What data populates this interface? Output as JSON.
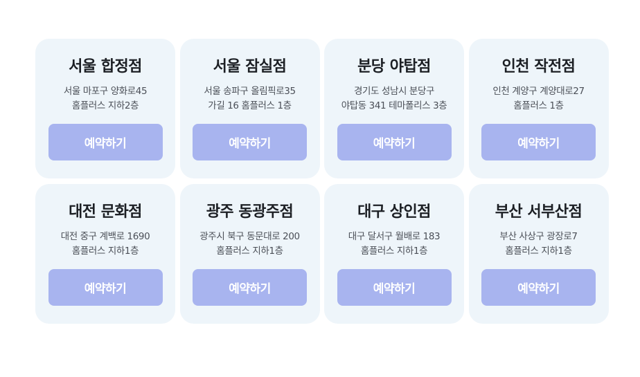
{
  "stores": [
    {
      "name": "서울 합정점",
      "address_line1": "서울 마포구 양화로45",
      "address_line2": "홈플러스 지하2층",
      "button_label": "예약하기"
    },
    {
      "name": "서울 잠실점",
      "address_line1": "서울 송파구 올림픽로35",
      "address_line2": "가길 16 홈플러스 1층",
      "button_label": "예약하기"
    },
    {
      "name": "분당 야탑점",
      "address_line1": "경기도 성남시 분당구",
      "address_line2": "야탑동 341 테마폴리스 3층",
      "button_label": "예약하기"
    },
    {
      "name": "인천 작전점",
      "address_line1": "인천 계양구 계양대로27",
      "address_line2": "홈플러스 1층",
      "button_label": "예약하기"
    },
    {
      "name": "대전 문화점",
      "address_line1": "대전 중구 계백로 1690",
      "address_line2": "홈플러스 지하1층",
      "button_label": "예약하기"
    },
    {
      "name": "광주 동광주점",
      "address_line1": "광주시 북구 동문대로 200",
      "address_line2": "홈플러스 지하1층",
      "button_label": "예약하기"
    },
    {
      "name": "대구 상인점",
      "address_line1": "대구 달서구 월배로 183",
      "address_line2": "홈플러스 지하1층",
      "button_label": "예약하기"
    },
    {
      "name": "부산 서부산점",
      "address_line1": "부산 사상구 광장로7",
      "address_line2": "홈플러스 지하1층",
      "button_label": "예약하기"
    }
  ],
  "colors": {
    "card_background": "#eef5fa",
    "button_background": "#a8b4ef",
    "button_text": "#ffffff",
    "title_text": "#1c1f24",
    "address_text": "#4b4f57"
  }
}
